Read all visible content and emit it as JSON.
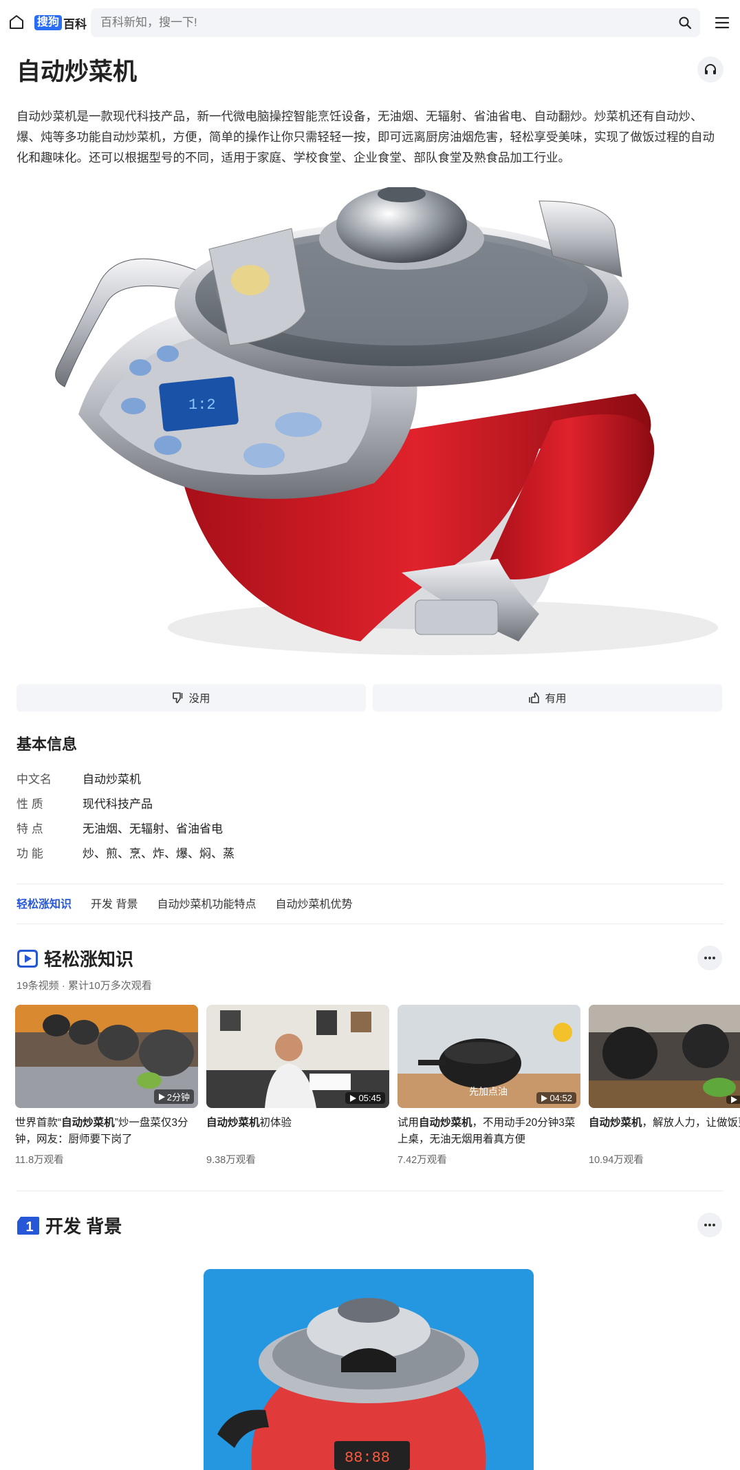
{
  "header": {
    "logo_badge": "搜狗",
    "logo_text": "百科",
    "search_placeholder": "百科新知，搜一下!"
  },
  "page": {
    "title": "自动炒菜机",
    "intro": "自动炒菜机是一款现代科技产品，新一代微电脑操控智能烹饪设备，无油烟、无辐射、省油省电、自动翻炒。炒菜机还有自动炒、爆、炖等多功能自动炒菜机，方便，简单的操作让你只需轻轻一按，即可远离厨房油烟危害，轻松享受美味，实现了做饭过程的自动化和趣味化。还可以根据型号的不同，适用于家庭、学校食堂、企业食堂、部队食堂及熟食品加工行业。"
  },
  "feedback": {
    "useless_label": "没用",
    "useful_label": "有用"
  },
  "basic_info": {
    "title": "基本信息",
    "rows": [
      {
        "key": "中文名",
        "value": "自动炒菜机"
      },
      {
        "key": "性 质",
        "value": "现代科技产品"
      },
      {
        "key": "特 点",
        "value": "无油烟、无辐射、省油省电"
      },
      {
        "key": "功 能",
        "value": "炒、煎、烹、炸、爆、焖、蒸"
      }
    ]
  },
  "tabs": [
    "轻松涨知识",
    "开发 背景",
    "自动炒菜机功能特点",
    "自动炒菜机优势"
  ],
  "knowledge": {
    "title": "轻松涨知识",
    "meta": "19条视频 · 累计10万多次观看",
    "videos": [
      {
        "title_pre": "世界首款“",
        "title_bold": "自动炒菜机",
        "title_post": "”炒一盘菜仅3分钟，网友：厨师要下岗了",
        "duration": "2分钟",
        "views": "11.8万观看"
      },
      {
        "title_pre": "",
        "title_bold": "自动炒菜机",
        "title_post": "初体验",
        "duration": "05:45",
        "views": "9.38万观看"
      },
      {
        "title_pre": "试用",
        "title_bold": "自动炒菜机",
        "title_post": "，不用动手20分钟3菜上桌，无油无烟用着真方便",
        "duration": "04:52",
        "caption": "先加点油",
        "views": "7.42万观看"
      },
      {
        "title_pre": "",
        "title_bold": "自动炒菜机",
        "title_post": "，解放人力，让做饭更",
        "duration": "",
        "views": "10.94万观看"
      }
    ]
  },
  "background": {
    "number": "1",
    "title": "开发 背景"
  },
  "colors": {
    "accent": "#2557d6",
    "logo": "#2a6df5",
    "machine_red": "#d8202a"
  }
}
